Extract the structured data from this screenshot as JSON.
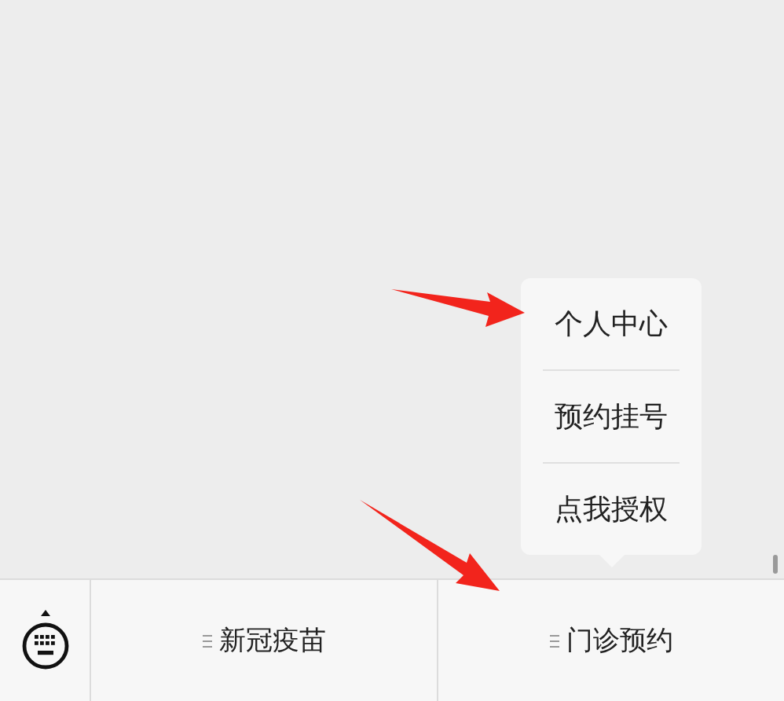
{
  "menu": [
    {
      "label": "新冠疫苗"
    },
    {
      "label": "门诊预约",
      "children": [
        {
          "label": "个人中心"
        },
        {
          "label": "预约挂号"
        },
        {
          "label": "点我授权"
        }
      ]
    }
  ]
}
